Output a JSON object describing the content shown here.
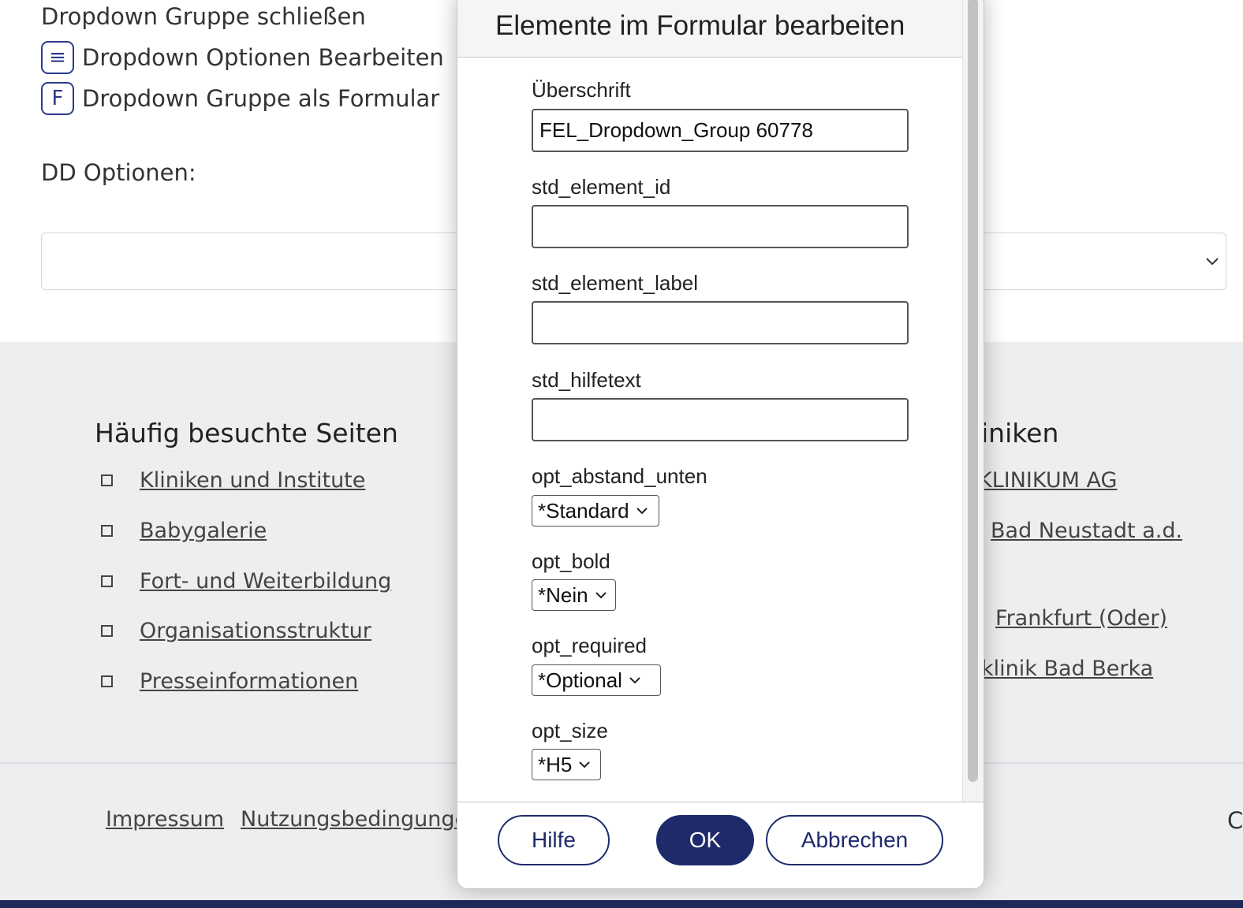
{
  "menu": {
    "close_group": "Dropdown Gruppe schließen",
    "edit_options": "Dropdown Optionen Bearbeiten",
    "edit_options_icon": "≡",
    "group_as_form": "Dropdown Gruppe als Formular",
    "group_as_form_icon": "F"
  },
  "dd_options_label": "DD Optionen:",
  "footer": {
    "frequent_title": "Häufig besuchte Seiten",
    "frequent_links": [
      "Kliniken und Institute",
      "Babygalerie",
      "Fort- und Weiterbildung",
      "Organisationsstruktur",
      "Presseinformationen"
    ],
    "right_title": "iniken",
    "right_links": [
      "KLINIKUM AG",
      "Bad Neustadt a.d.",
      "Frankfurt (Oder)",
      "klinik Bad Berka"
    ],
    "legal_links": [
      "Impressum",
      "Nutzungsbedingungen"
    ],
    "edge_char": "C"
  },
  "dialog": {
    "title": "Elemente im Formular bearbeiten",
    "fields": {
      "heading_label": "Überschrift",
      "heading_value": "FEL_Dropdown_Group 60778",
      "element_id_label": "std_element_id",
      "element_id_value": "",
      "element_label_label": "std_element_label",
      "element_label_value": "",
      "helptext_label": "std_hilfetext",
      "helptext_value": "",
      "spacing_label": "opt_abstand_unten",
      "spacing_value": "*Standard",
      "bold_label": "opt_bold",
      "bold_value": "*Nein",
      "required_label": "opt_required",
      "required_value": "*Optional",
      "size_label": "opt_size",
      "size_value": "*H5"
    },
    "buttons": {
      "help": "Hilfe",
      "ok": "OK",
      "cancel": "Abbrechen"
    }
  },
  "colors": {
    "brand": "#1f2a6b",
    "footer_bg": "#edeef0",
    "icon_border": "#2b3a8c"
  }
}
